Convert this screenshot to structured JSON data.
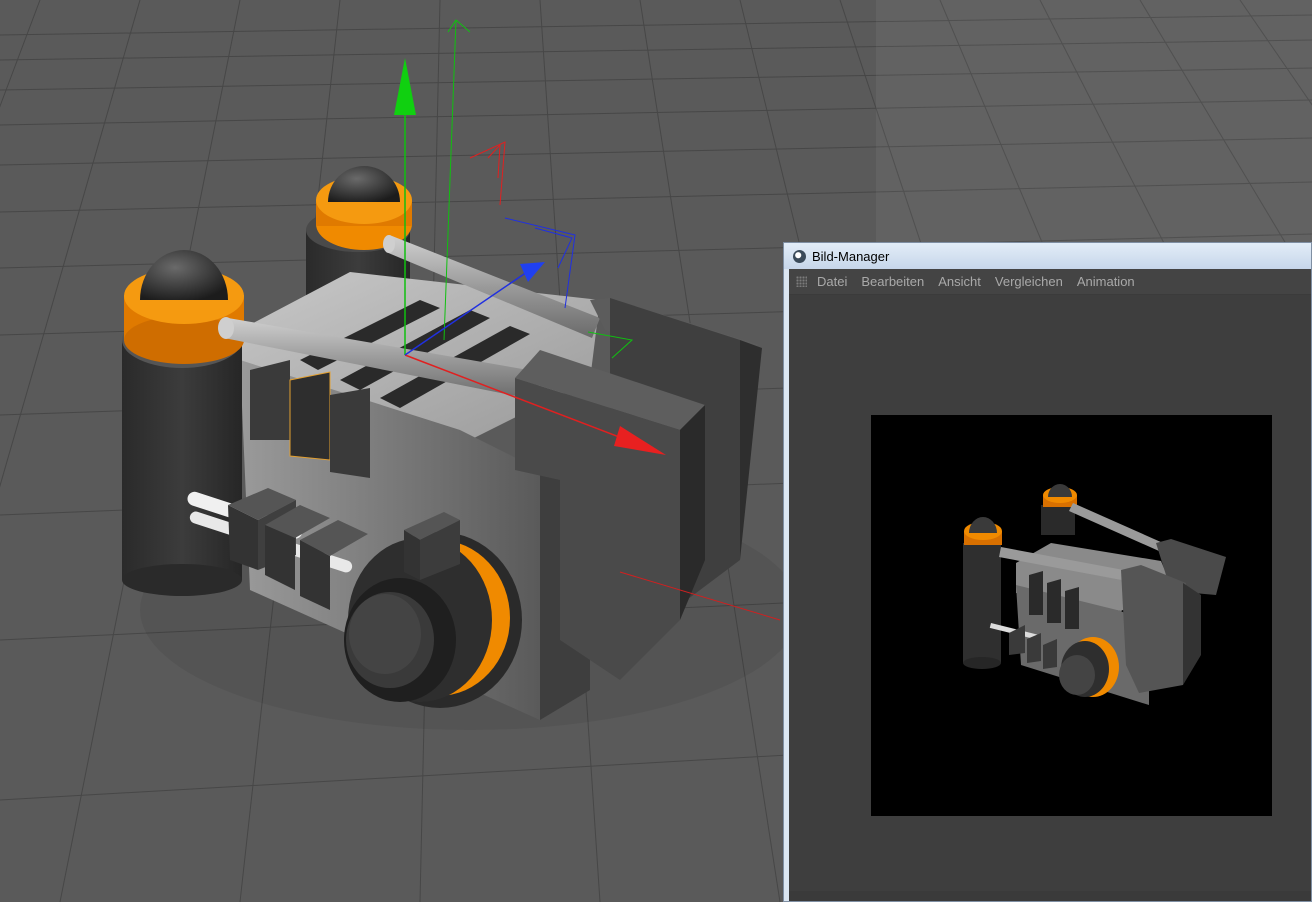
{
  "viewport": {
    "background": "#5a5a5a",
    "grid_color": "#444444",
    "accent_orange": "#f08a00",
    "axis_x_color": "#e02020",
    "axis_y_color": "#10c010",
    "axis_z_color": "#2030e0"
  },
  "image_manager": {
    "title": "Bild-Manager",
    "menu": [
      {
        "label": "Datei"
      },
      {
        "label": "Bearbeiten"
      },
      {
        "label": "Ansicht"
      },
      {
        "label": "Vergleichen"
      },
      {
        "label": "Animation"
      }
    ],
    "render_background": "#000000"
  }
}
